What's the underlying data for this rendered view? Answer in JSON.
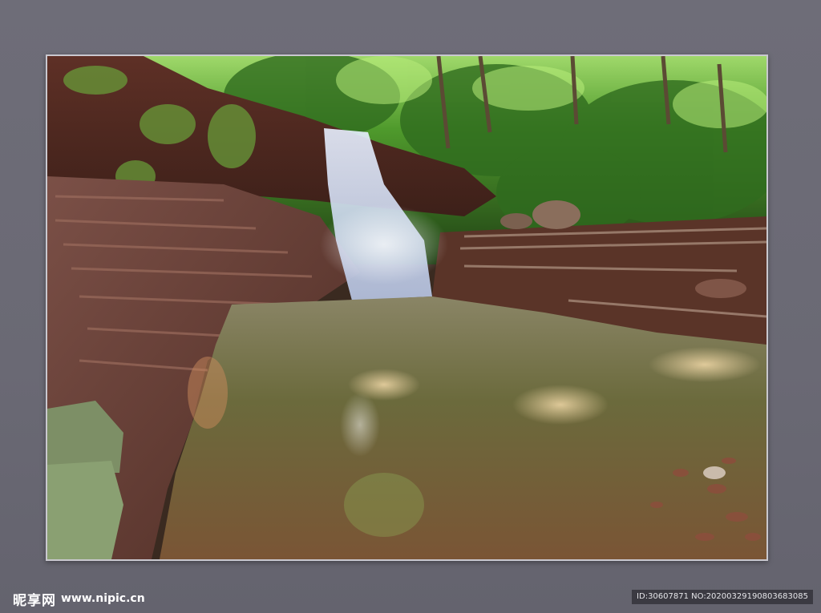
{
  "photo": {
    "subject": "waterfall",
    "colors": {
      "background": "#6a6974",
      "frame_border": "#c9c8cf",
      "foliage": "#3f8a2a",
      "rock": "#6b3f33",
      "water": "#7d7a52"
    }
  },
  "watermark": {
    "brand_text": "昵享网",
    "url_text": "www.nipic.cn",
    "id_text": "ID:30607871 NO:20200329190803683085"
  }
}
